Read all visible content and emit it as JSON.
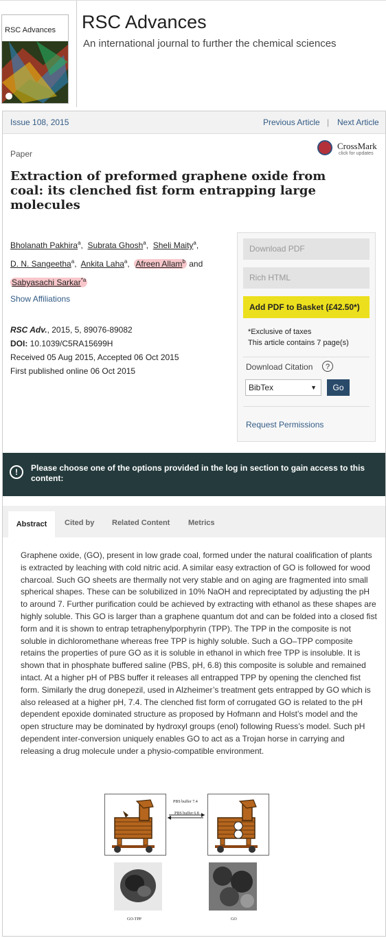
{
  "header": {
    "cover_title": "RSC Advances",
    "journal_title": "RSC Advances",
    "journal_subtitle": "An international journal to further the chemical sciences"
  },
  "issue_bar": {
    "issue": "Issue 108, 2015",
    "previous": "Previous Article",
    "separator": "|",
    "next": "Next Article"
  },
  "article": {
    "type": "Paper",
    "crossmark": "CrossMark",
    "crossmark_sub": "click for updates",
    "title": "Extraction of preformed graphene oxide from coal: its clenched fist form entrapping large molecules",
    "authors": [
      {
        "name": "Bholanath Pakhira",
        "sup": "a"
      },
      {
        "name": "Subrata Ghosh",
        "sup": "a"
      },
      {
        "name": "Sheli Maity",
        "sup": "a"
      },
      {
        "name": "D. N. Sangeetha",
        "sup": "a"
      },
      {
        "name": "Ankita Laha",
        "sup": "a"
      },
      {
        "name": "Afreen Allam",
        "sup": "b"
      },
      {
        "name": "Sabyasachi Sarkar",
        "sup": "*a"
      }
    ],
    "and": "and",
    "show_affiliations": "Show Affiliations",
    "journal_ref": "RSC Adv.",
    "ref_detail": ", 2015, 5, 89076-89082",
    "doi_label": "DOI:",
    "doi": " 10.1039/C5RA15699H",
    "received": "Received 05 Aug 2015, Accepted 06 Oct 2015",
    "published": "First published online 06 Oct 2015"
  },
  "sidebar": {
    "download_pdf": "Download PDF",
    "rich_html": "Rich HTML",
    "add_pdf": "Add PDF to Basket (£42.50*)",
    "taxes": "*Exclusive of taxes",
    "pages": "This article contains 7 page(s)",
    "download_citation": "Download Citation",
    "help": "?",
    "format": "BibTex",
    "go": "Go",
    "request_permissions": "Request Permissions"
  },
  "alert": {
    "icon": "!",
    "text": "Please choose one of the options provided in the log in section to gain access to this content:"
  },
  "tabs": {
    "abstract": "Abstract",
    "cited_by": "Cited by",
    "related": "Related Content",
    "metrics": "Metrics"
  },
  "abstract_text": "Graphene oxide, (GO), present in low grade coal, formed under the natural coalification of plants is extracted by leaching with cold nitric acid. A similar easy extraction of GO is followed for wood charcoal. Such GO sheets are thermally not very stable and on aging are fragmented into small spherical shapes. These can be solubilized in 10% NaOH and repreciptated by adjusting the pH to around 7. Further purification could be achieved by extracting with ethanol as these shapes are highly soluble. This GO is larger than a graphene quantum dot and can be folded into a closed fist form and it is shown to entrap tetraphenylporphyrin (TPP). The TPP in the composite is not soluble in dichloromethane whereas free TPP is highly soluble. Such a GO–TPP composite retains the properties of pure GO as it is soluble in ethanol in which free TPP is insoluble. It is shown that in phosphate buffered saline (PBS, pH, 6.8) this composite is soluble and remained intact. At a higher pH of PBS buffer it releases all entrapped TPP by opening the clenched fist form. Similarly the drug donepezil, used in Alzheimer’s treatment gets entrapped by GO which is also released at a higher pH, 7.4. The clenched fist form of corrugated GO is related to the pH dependent epoxide dominated structure as proposed by Hofmann and Holst’s model and the open structure may be dominated by hydroxyl groups (enol) following Ruess’s model. Such pH dependent inter-conversion uniquely enables GO to act as a Trojan horse in carrying and releasing a drug molecule under a physio-compatible environment.",
  "graphic": {
    "arrow_top": "PBS buffer 7.4",
    "arrow_bottom": "PBS buffer 6.8",
    "caption_left": "GO-TPP",
    "caption_right": "GO"
  },
  "colors": {
    "link": "#335b85",
    "basket": "#ece01e",
    "alert_bg": "#243a3c",
    "go_button": "#2a4a6a"
  }
}
